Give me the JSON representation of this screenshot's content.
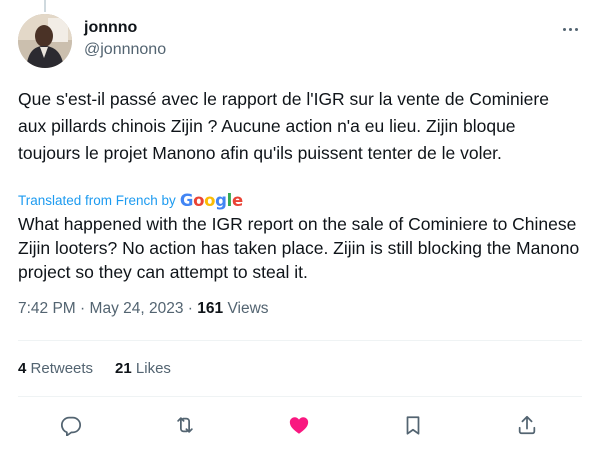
{
  "tweet": {
    "display_name": "jonnno",
    "handle": "@jonnnono",
    "original_text": "Que s'est-il passé avec le rapport de l'IGR sur la vente de Cominiere aux pillards chinois Zijin ? Aucune action n'a eu lieu. Zijin bloque toujours le projet Manono afin qu'ils puissent tenter de le voler.",
    "translated_label": "Translated from French by",
    "google_logo": {
      "G": "G",
      "o1": "o",
      "o2": "o",
      "g": "g",
      "l": "l",
      "e": "e"
    },
    "translation": "What happened with the IGR report on the sale of Cominiere to Chinese Zijin looters? No action has taken place. Zijin is still blocking the Manono project so they can attempt to steal it.",
    "time": "7:42 PM",
    "separator": "·",
    "date": "May 24, 2023",
    "views_count": "161",
    "views_label": "Views"
  },
  "stats": {
    "retweets_count": "4",
    "retweets_label": "Retweets",
    "likes_count": "21",
    "likes_label": "Likes"
  },
  "colors": {
    "text": "#0f1419",
    "secondary": "#536471",
    "link": "#1d9bf0",
    "like_active": "#f91880",
    "icon": "#536471"
  },
  "icons": {
    "reply": "reply-icon",
    "retweet": "retweet-icon",
    "like": "heart-icon",
    "bookmark": "bookmark-icon",
    "share": "share-icon",
    "more": "more-icon"
  }
}
